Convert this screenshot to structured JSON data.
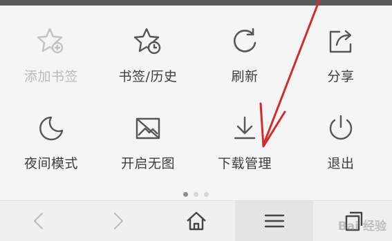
{
  "menu": {
    "items": [
      {
        "icon": "star-plus-icon",
        "label": "添加书签",
        "enabled": false
      },
      {
        "icon": "star-clock-icon",
        "label": "书签/历史",
        "enabled": true
      },
      {
        "icon": "refresh-icon",
        "label": "刷新",
        "enabled": true
      },
      {
        "icon": "share-icon",
        "label": "分享",
        "enabled": true
      },
      {
        "icon": "moon-icon",
        "label": "夜间模式",
        "enabled": true
      },
      {
        "icon": "no-image-icon",
        "label": "开启无图",
        "enabled": true
      },
      {
        "icon": "download-icon",
        "label": "下载管理",
        "enabled": true
      },
      {
        "icon": "power-icon",
        "label": "退出",
        "enabled": true
      }
    ]
  },
  "pagination": {
    "pages": 3,
    "current": 1
  },
  "bottom_bar": {
    "buttons": [
      {
        "icon": "back-arrow-icon"
      },
      {
        "icon": "forward-arrow-icon"
      },
      {
        "icon": "home-icon"
      },
      {
        "icon": "menu-icon",
        "active": true
      },
      {
        "icon": "tabs-icon"
      }
    ]
  },
  "watermark": {
    "text": "Bai 经验"
  },
  "colors": {
    "icon": "#555555",
    "icon_disabled": "#b9b9b9",
    "annotation_arrow": "#d62a2a"
  }
}
